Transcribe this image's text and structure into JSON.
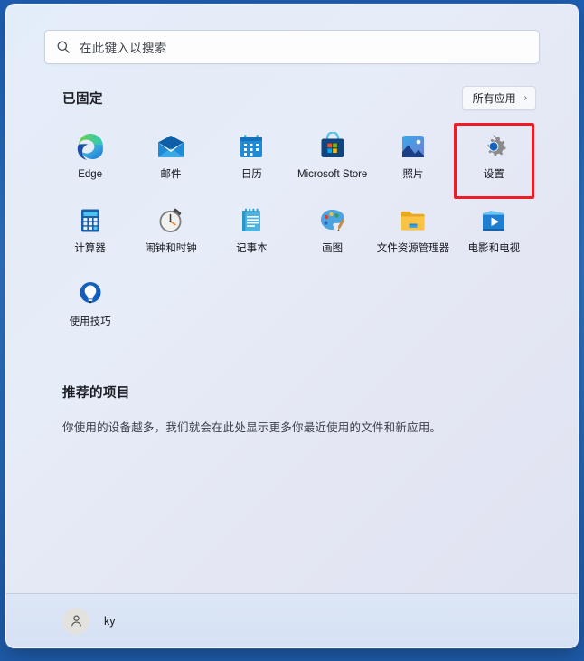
{
  "search": {
    "placeholder": "在此键入以搜索",
    "icon": "search-icon"
  },
  "pinned": {
    "title": "已固定",
    "all_apps_label": "所有应用",
    "all_apps_chevron": "›",
    "apps": [
      {
        "label": "Edge",
        "icon": "edge-icon"
      },
      {
        "label": "邮件",
        "icon": "mail-icon"
      },
      {
        "label": "日历",
        "icon": "calendar-icon"
      },
      {
        "label": "Microsoft Store",
        "icon": "microsoft-store-icon"
      },
      {
        "label": "照片",
        "icon": "photos-icon"
      },
      {
        "label": "设置",
        "icon": "settings-gear-icon",
        "highlighted": true
      },
      {
        "label": "计算器",
        "icon": "calculator-icon"
      },
      {
        "label": "闹钟和时钟",
        "icon": "alarm-clock-icon"
      },
      {
        "label": "记事本",
        "icon": "notepad-icon"
      },
      {
        "label": "画图",
        "icon": "paint-palette-icon"
      },
      {
        "label": "文件资源管理器",
        "icon": "file-explorer-icon"
      },
      {
        "label": "电影和电视",
        "icon": "movies-tv-icon"
      },
      {
        "label": "使用技巧",
        "icon": "tips-lightbulb-icon"
      }
    ]
  },
  "recommended": {
    "title": "推荐的项目",
    "subtitle": "你使用的设备越多，我们就会在此处显示更多你最近使用的文件和新应用。"
  },
  "user": {
    "name": "ky",
    "avatar_icon": "person-avatar-icon"
  },
  "colors": {
    "highlight_box": "#ee1c25",
    "panel_bg": "#e4e9f6",
    "desktop_bg": "#2f76c7"
  }
}
